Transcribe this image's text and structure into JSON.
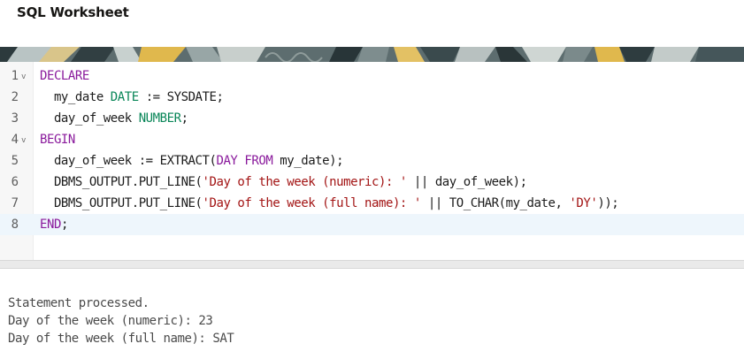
{
  "worksheet": {
    "title": "SQL Worksheet"
  },
  "editor": {
    "line_numbers": [
      "1",
      "2",
      "3",
      "4",
      "5",
      "6",
      "7",
      "8"
    ],
    "fold_markers": [
      "v",
      "v"
    ],
    "active_line": 8,
    "lines": [
      [
        {
          "t": "DECLARE",
          "c": "kw"
        }
      ],
      [
        {
          "t": "  my_date ",
          "c": ""
        },
        {
          "t": "DATE",
          "c": "ty"
        },
        {
          "t": " := SYSDATE;",
          "c": ""
        }
      ],
      [
        {
          "t": "  day_of_week ",
          "c": ""
        },
        {
          "t": "NUMBER",
          "c": "ty"
        },
        {
          "t": ";",
          "c": ""
        }
      ],
      [
        {
          "t": "BEGIN",
          "c": "kw"
        }
      ],
      [
        {
          "t": "  day_of_week := EXTRACT(",
          "c": ""
        },
        {
          "t": "DAY",
          "c": "kw"
        },
        {
          "t": " ",
          "c": ""
        },
        {
          "t": "FROM",
          "c": "kw"
        },
        {
          "t": " my_date);",
          "c": ""
        }
      ],
      [
        {
          "t": "  DBMS_OUTPUT.PUT_LINE(",
          "c": ""
        },
        {
          "t": "'Day of the week (numeric): '",
          "c": "st"
        },
        {
          "t": " || day_of_week);",
          "c": ""
        }
      ],
      [
        {
          "t": "  DBMS_OUTPUT.PUT_LINE(",
          "c": ""
        },
        {
          "t": "'Day of the week (full name): '",
          "c": "st"
        },
        {
          "t": " || TO_CHAR(my_date, ",
          "c": ""
        },
        {
          "t": "'DY'",
          "c": "st"
        },
        {
          "t": "));",
          "c": ""
        }
      ],
      [
        {
          "t": "END",
          "c": "kw"
        },
        {
          "t": ";",
          "c": ""
        }
      ]
    ]
  },
  "output": {
    "lines": [
      "Statement processed.",
      "Day of the week (numeric): 23",
      "Day of the week (full name): SAT"
    ]
  },
  "colors": {
    "keyword": "#8a1a9c",
    "type": "#098658",
    "string": "#a31515",
    "active_line": "#eef6fc"
  }
}
